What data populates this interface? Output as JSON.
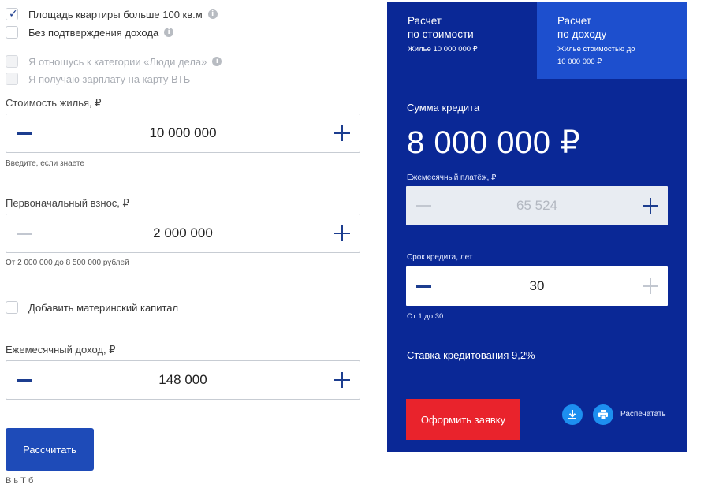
{
  "checkboxes": [
    {
      "label": "Площадь квартиры больше 100 кв.м",
      "checked": true,
      "disabled": false,
      "info": true
    },
    {
      "label": "Без подтверждения дохода",
      "checked": false,
      "disabled": false,
      "info": true
    },
    {
      "label": "Я отношусь к категории «Люди дела»",
      "checked": false,
      "disabled": true,
      "info": true
    },
    {
      "label": "Я получаю зарплату на карту ВТБ",
      "checked": false,
      "disabled": true,
      "info": false
    }
  ],
  "property_cost": {
    "label": "Стоимость жилья, ₽",
    "value": "10 000 000",
    "hint": "Введите, если знаете"
  },
  "down_payment": {
    "label": "Первоначальный взнос, ₽",
    "value": "2 000 000",
    "hint": "От 2 000 000 до 8 500 000 рублей"
  },
  "maternity_capital": {
    "label": "Добавить материнский капитал",
    "checked": false
  },
  "monthly_income": {
    "label": "Ежемесячный доход, ₽",
    "value": "148 000"
  },
  "calculate_button": "Рассчитать",
  "bottom_cut_text": "В           ь                                                Т                                 б",
  "panel": {
    "tabs": [
      {
        "title_line1": "Расчет",
        "title_line2": "по стоимости",
        "subtitle": "Жилье 10 000 000 ₽",
        "active": true
      },
      {
        "title_line1": "Расчет",
        "title_line2": "по доходу",
        "subtitle_line1": "Жилье стоимостью до",
        "subtitle_line2": "10 000 000 ₽",
        "active": false
      }
    ],
    "credit_sum_label": "Сумма кредита",
    "credit_sum_value": "8 000 000 ₽",
    "monthly_payment_label": "Ежемесячный платёж, ₽",
    "monthly_payment_value": "65 524",
    "term_label": "Срок кредита, лет",
    "term_value": "30",
    "term_hint": "От 1 до 30",
    "rate_text": "Ставка кредитования 9,2%",
    "apply_button": "Оформить заявку",
    "print_label": "Распечатать"
  },
  "icons": {
    "info": "info-icon",
    "download": "download-icon",
    "print": "printer-icon"
  },
  "colors": {
    "panel_bg": "#0a2896",
    "active_tab_bg": "#1d4fce",
    "accent_blue": "#1c3d8f",
    "calc_button": "#1e4bb8",
    "apply_button": "#e9232c",
    "icon_circle": "#1d8ff0"
  }
}
